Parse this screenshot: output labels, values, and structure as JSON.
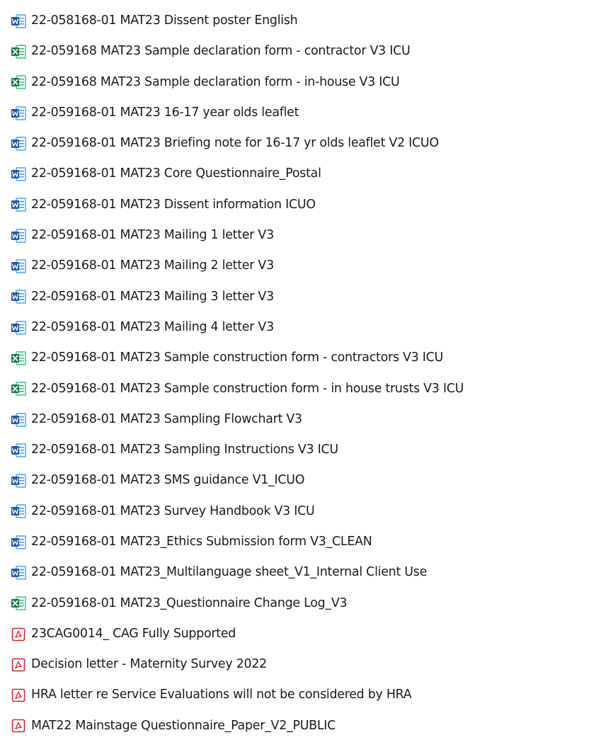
{
  "colors": {
    "word": "#2b579a",
    "excel": "#217346",
    "pdf": "#d4242a"
  },
  "files": [
    {
      "name": "22-058168-01 MAT23 Dissent poster English",
      "type": "word",
      "icon": "word-doc-icon"
    },
    {
      "name": "22-059168 MAT23 Sample declaration form - contractor V3 ICU",
      "type": "excel",
      "icon": "excel-sheet-icon"
    },
    {
      "name": "22-059168 MAT23 Sample declaration form - in-house V3 ICU",
      "type": "excel",
      "icon": "excel-sheet-icon"
    },
    {
      "name": "22-059168-01 MAT23 16-17 year olds leaflet",
      "type": "word",
      "icon": "word-doc-icon"
    },
    {
      "name": "22-059168-01 MAT23 Briefing note for 16-17 yr olds leaflet V2 ICUO",
      "type": "word",
      "icon": "word-doc-icon"
    },
    {
      "name": "22-059168-01 MAT23 Core Questionnaire_Postal",
      "type": "word",
      "icon": "word-doc-icon"
    },
    {
      "name": "22-059168-01 MAT23 Dissent information ICUO",
      "type": "word",
      "icon": "word-doc-icon"
    },
    {
      "name": "22-059168-01 MAT23 Mailing 1 letter V3",
      "type": "word",
      "icon": "word-doc-icon"
    },
    {
      "name": "22-059168-01 MAT23 Mailing 2 letter V3",
      "type": "word",
      "icon": "word-doc-icon"
    },
    {
      "name": "22-059168-01 MAT23 Mailing 3 letter V3",
      "type": "word",
      "icon": "word-doc-icon"
    },
    {
      "name": "22-059168-01 MAT23 Mailing 4 letter V3",
      "type": "word",
      "icon": "word-doc-icon"
    },
    {
      "name": "22-059168-01 MAT23 Sample construction form - contractors V3 ICU",
      "type": "excel",
      "icon": "excel-sheet-icon"
    },
    {
      "name": "22-059168-01 MAT23 Sample construction form - in house trusts V3 ICU",
      "type": "excel",
      "icon": "excel-sheet-icon"
    },
    {
      "name": "22-059168-01 MAT23 Sampling Flowchart V3",
      "type": "word",
      "icon": "word-doc-icon"
    },
    {
      "name": "22-059168-01 MAT23 Sampling Instructions V3 ICU",
      "type": "word",
      "icon": "word-doc-icon"
    },
    {
      "name": "22-059168-01 MAT23 SMS guidance V1_ICUO",
      "type": "word",
      "icon": "word-doc-icon"
    },
    {
      "name": "22-059168-01 MAT23 Survey Handbook V3 ICU",
      "type": "word",
      "icon": "word-doc-icon"
    },
    {
      "name": "22-059168-01 MAT23_Ethics Submission form V3_CLEAN",
      "type": "word",
      "icon": "word-doc-icon"
    },
    {
      "name": "22-059168-01 MAT23_Multilanguage sheet_V1_Internal Client Use",
      "type": "word",
      "icon": "word-doc-icon"
    },
    {
      "name": "22-059168-01 MAT23_Questionnaire Change Log_V3",
      "type": "excel",
      "icon": "excel-sheet-icon"
    },
    {
      "name": "23CAG0014_ CAG Fully Supported",
      "type": "pdf",
      "icon": "pdf-file-icon"
    },
    {
      "name": "Decision letter - Maternity Survey 2022",
      "type": "pdf",
      "icon": "pdf-file-icon"
    },
    {
      "name": "HRA letter re Service Evaluations will not be considered by HRA",
      "type": "pdf",
      "icon": "pdf-file-icon"
    },
    {
      "name": "MAT22 Mainstage Questionnaire_Paper_V2_PUBLIC",
      "type": "pdf",
      "icon": "pdf-file-icon"
    }
  ]
}
